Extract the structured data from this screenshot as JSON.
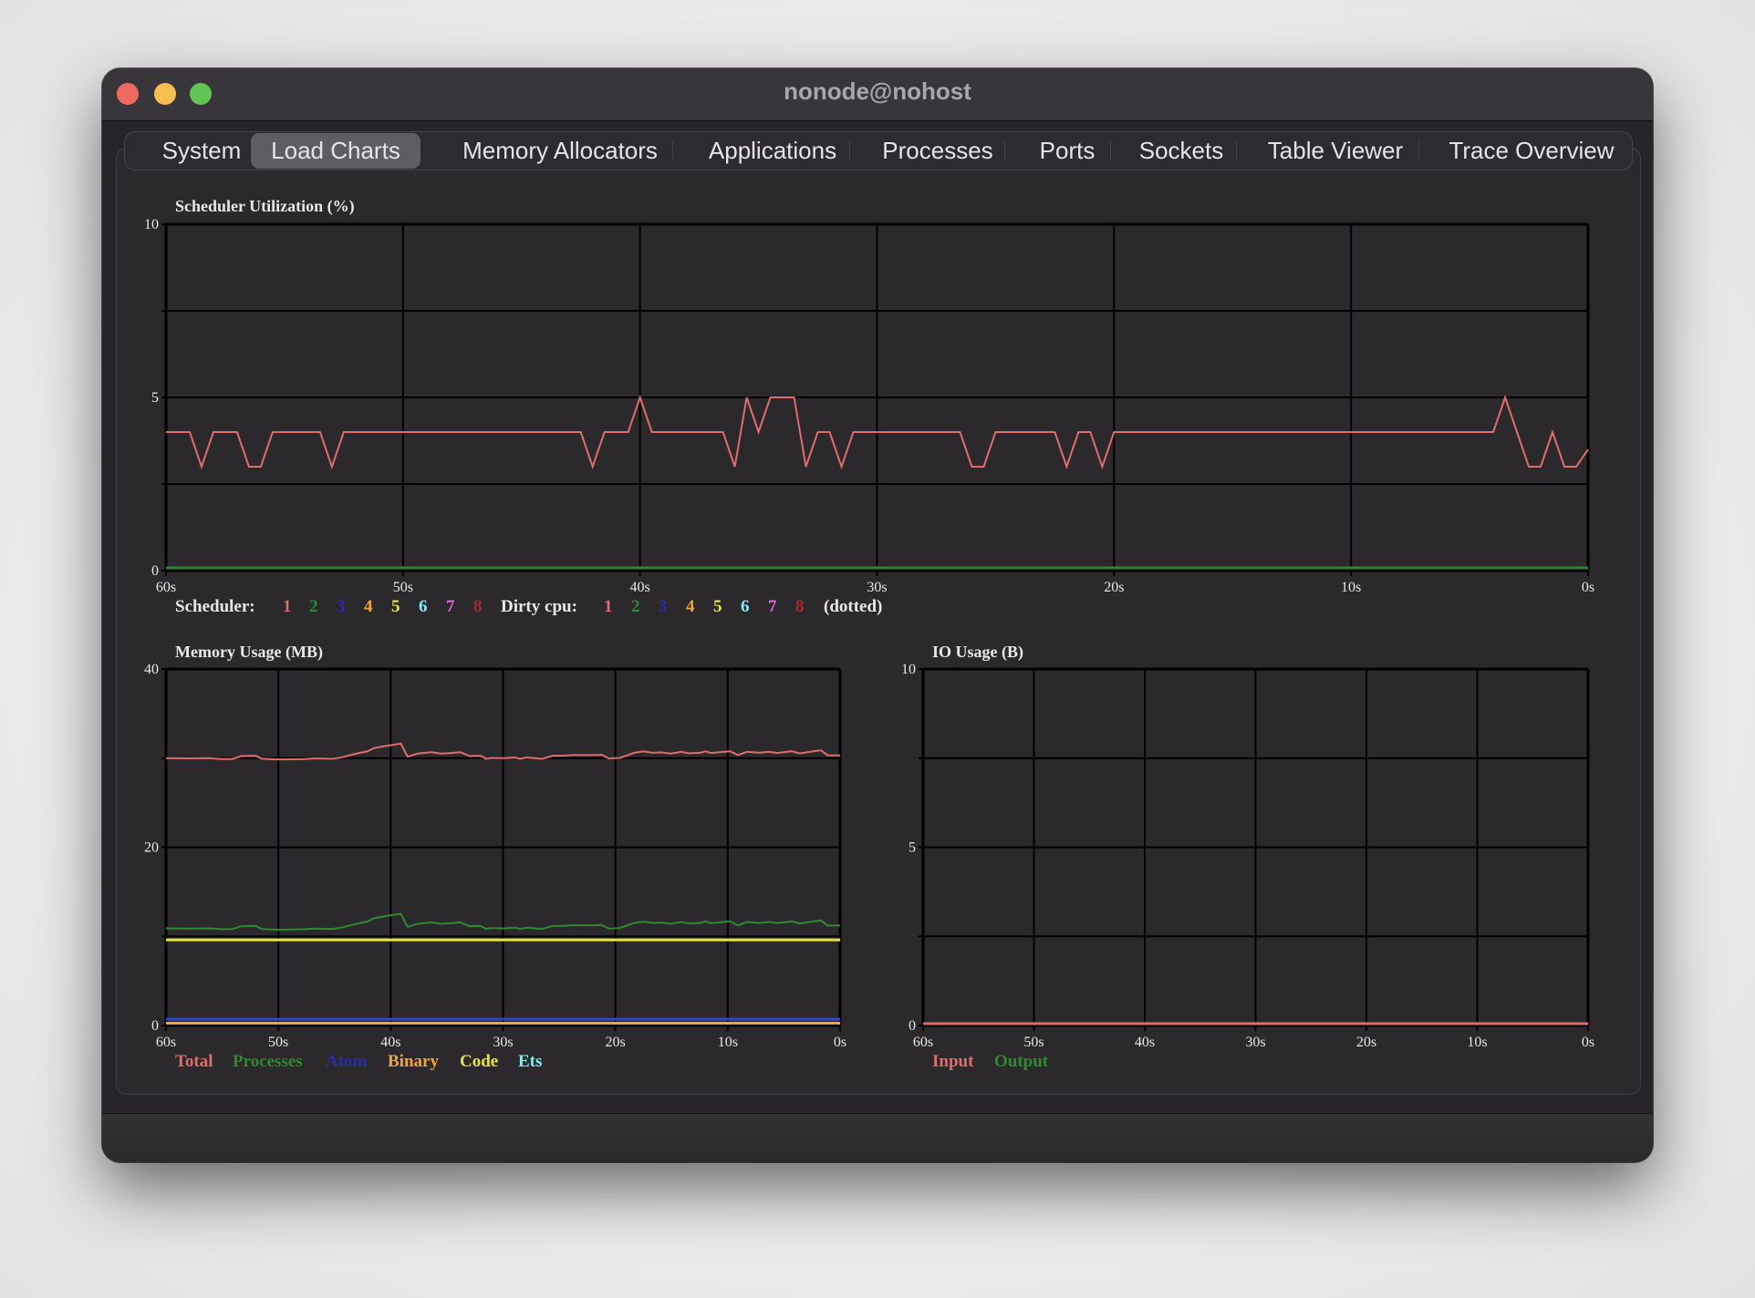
{
  "window": {
    "title": "nonode@nohost"
  },
  "tabs": [
    {
      "label": "System",
      "active": false
    },
    {
      "label": "Load Charts",
      "active": true
    },
    {
      "label": "Memory Allocators",
      "active": false
    },
    {
      "label": "Applications",
      "active": false
    },
    {
      "label": "Processes",
      "active": false
    },
    {
      "label": "Ports",
      "active": false
    },
    {
      "label": "Sockets",
      "active": false
    },
    {
      "label": "Table Viewer",
      "active": false
    },
    {
      "label": "Trace Overview",
      "active": false
    }
  ],
  "chart_data": [
    {
      "type": "line",
      "title": "Scheduler Utilization (%)",
      "xlabel": "",
      "ylabel": "",
      "x_ticks": [
        "60s",
        "50s",
        "40s",
        "30s",
        "20s",
        "10s",
        "0s"
      ],
      "y_ticks": [
        "0",
        "5",
        "10"
      ],
      "ylim": [
        0,
        10
      ],
      "xlim": [
        60,
        0
      ],
      "x_step_seconds": 0.5,
      "grid": true,
      "legend_position": "bottom-left",
      "legend": {
        "scheduler_label": "Scheduler:",
        "dirty_label": "Dirty cpu:",
        "dotted_label": "(dotted)",
        "items": [
          "1",
          "2",
          "3",
          "4",
          "5",
          "6",
          "7",
          "8"
        ],
        "colors": [
          "#e06c6c",
          "#2f8a2f",
          "#2b2bab",
          "#f2a33a",
          "#e8e24a",
          "#86eaf2",
          "#de63de",
          "#a42b2b"
        ]
      },
      "series": [
        {
          "name": "Scheduler 1",
          "color": "#e06c6c",
          "values": [
            4,
            4,
            4,
            3,
            4,
            4,
            4,
            3,
            3,
            4,
            4,
            4,
            4,
            4,
            3,
            4,
            4,
            4,
            4,
            4,
            4,
            4,
            4,
            4,
            4,
            4,
            4,
            4,
            4,
            4,
            4,
            4,
            4,
            4,
            4,
            4,
            3,
            4,
            4,
            4,
            5,
            4,
            4,
            4,
            4,
            4,
            4,
            4,
            3,
            5,
            4,
            5,
            5,
            5,
            3,
            4,
            4,
            3,
            4,
            4,
            4,
            4,
            4,
            4,
            4,
            4,
            4,
            4,
            3,
            3,
            4,
            4,
            4,
            4,
            4,
            4,
            3,
            4,
            4,
            3,
            4,
            4,
            4,
            4,
            4,
            4,
            4,
            4,
            4,
            4,
            4,
            4,
            4,
            4,
            4,
            4,
            4,
            4,
            4,
            4,
            4,
            4,
            4,
            4,
            4,
            4,
            4,
            4,
            4,
            4,
            4,
            4,
            4,
            5,
            4,
            3,
            3,
            4,
            3,
            3,
            3.5
          ]
        },
        {
          "name": "Scheduler 2",
          "color": "#2f8a2f",
          "values": [
            0,
            0
          ]
        }
      ]
    },
    {
      "type": "line",
      "title": "Memory Usage (MB)",
      "x_ticks": [
        "60s",
        "50s",
        "40s",
        "30s",
        "20s",
        "10s",
        "0s"
      ],
      "y_ticks": [
        "0",
        "20",
        "40"
      ],
      "ylim": [
        0,
        40
      ],
      "xlim": [
        60,
        0
      ],
      "grid": true,
      "legend_position": "bottom-left",
      "series": [
        {
          "name": "Total",
          "color": "#e06c6c",
          "points": [
            [
              60,
              30.0
            ],
            [
              58,
              29.97
            ],
            [
              56.1,
              30.0
            ],
            [
              55.1,
              29.9
            ],
            [
              54.1,
              29.9
            ],
            [
              53.3,
              30.24
            ],
            [
              52,
              30.27
            ],
            [
              51.5,
              29.93
            ],
            [
              50.2,
              29.86
            ],
            [
              49.2,
              29.86
            ],
            [
              47.6,
              29.9
            ],
            [
              46.8,
              29.97
            ],
            [
              45.2,
              29.93
            ],
            [
              44.4,
              30.07
            ],
            [
              43.7,
              30.31
            ],
            [
              42.7,
              30.61
            ],
            [
              42.1,
              30.75
            ],
            [
              41.5,
              31.12
            ],
            [
              40.5,
              31.36
            ],
            [
              39.1,
              31.63
            ],
            [
              38.5,
              30.17
            ],
            [
              37.6,
              30.51
            ],
            [
              36.4,
              30.68
            ],
            [
              35.6,
              30.51
            ],
            [
              34.6,
              30.58
            ],
            [
              33.8,
              30.68
            ],
            [
              33,
              30.24
            ],
            [
              32,
              30.27
            ],
            [
              31.5,
              29.93
            ],
            [
              31.1,
              30.03
            ],
            [
              29.9,
              30.0
            ],
            [
              28.9,
              30.07
            ],
            [
              28.5,
              29.93
            ],
            [
              27.9,
              30.07
            ],
            [
              26.5,
              29.93
            ],
            [
              25.6,
              30.27
            ],
            [
              24.8,
              30.27
            ],
            [
              23.8,
              30.34
            ],
            [
              22.2,
              30.34
            ],
            [
              21.2,
              30.37
            ],
            [
              20.6,
              29.97
            ],
            [
              19.6,
              30.03
            ],
            [
              18.3,
              30.61
            ],
            [
              17.5,
              30.75
            ],
            [
              16.7,
              30.61
            ],
            [
              15.9,
              30.65
            ],
            [
              15.1,
              30.51
            ],
            [
              14.1,
              30.71
            ],
            [
              13.5,
              30.54
            ],
            [
              12.4,
              30.61
            ],
            [
              12,
              30.78
            ],
            [
              11.5,
              30.58
            ],
            [
              10.6,
              30.68
            ],
            [
              9.8,
              30.78
            ],
            [
              9.1,
              30.34
            ],
            [
              8.3,
              30.71
            ],
            [
              7.2,
              30.61
            ],
            [
              6.3,
              30.71
            ],
            [
              5.6,
              30.58
            ],
            [
              4.3,
              30.78
            ],
            [
              3.6,
              30.54
            ],
            [
              2.5,
              30.75
            ],
            [
              1.7,
              30.88
            ],
            [
              1.1,
              30.31
            ],
            [
              0,
              30.31
            ]
          ]
        },
        {
          "name": "Processes",
          "color": "#2f8a2f",
          "offset_from_total": -19.1
        },
        {
          "name": "Atom",
          "color": "#2f46c8",
          "constant": 0.7
        },
        {
          "name": "Binary",
          "color": "#f2a33a",
          "constant": 0.25
        },
        {
          "name": "Code",
          "color": "#e8e24a",
          "constant": 9.6
        },
        {
          "name": "Ets",
          "color": "#86eaf2",
          "constant": null
        }
      ],
      "legend": [
        {
          "label": "Total",
          "color": "#e06c6c"
        },
        {
          "label": "Processes",
          "color": "#2f8a2f"
        },
        {
          "label": "Atom",
          "color": "#2b2bab"
        },
        {
          "label": "Binary",
          "color": "#f2a33a"
        },
        {
          "label": "Code",
          "color": "#e8e24a"
        },
        {
          "label": "Ets",
          "color": "#86eaf2"
        }
      ]
    },
    {
      "type": "line",
      "title": "IO Usage (B)",
      "x_ticks": [
        "60s",
        "50s",
        "40s",
        "30s",
        "20s",
        "10s",
        "0s"
      ],
      "y_ticks": [
        "0",
        "5",
        "10"
      ],
      "ylim": [
        0,
        10
      ],
      "xlim": [
        60,
        0
      ],
      "grid": true,
      "legend_position": "bottom-left",
      "series": [
        {
          "name": "Input",
          "color": "#e06c6c",
          "constant": 0
        },
        {
          "name": "Output",
          "color": "#2f8a2f",
          "constant": 0
        }
      ],
      "legend": [
        {
          "label": "Input",
          "color": "#e06c6c"
        },
        {
          "label": "Output",
          "color": "#2f8a2f"
        }
      ]
    }
  ]
}
